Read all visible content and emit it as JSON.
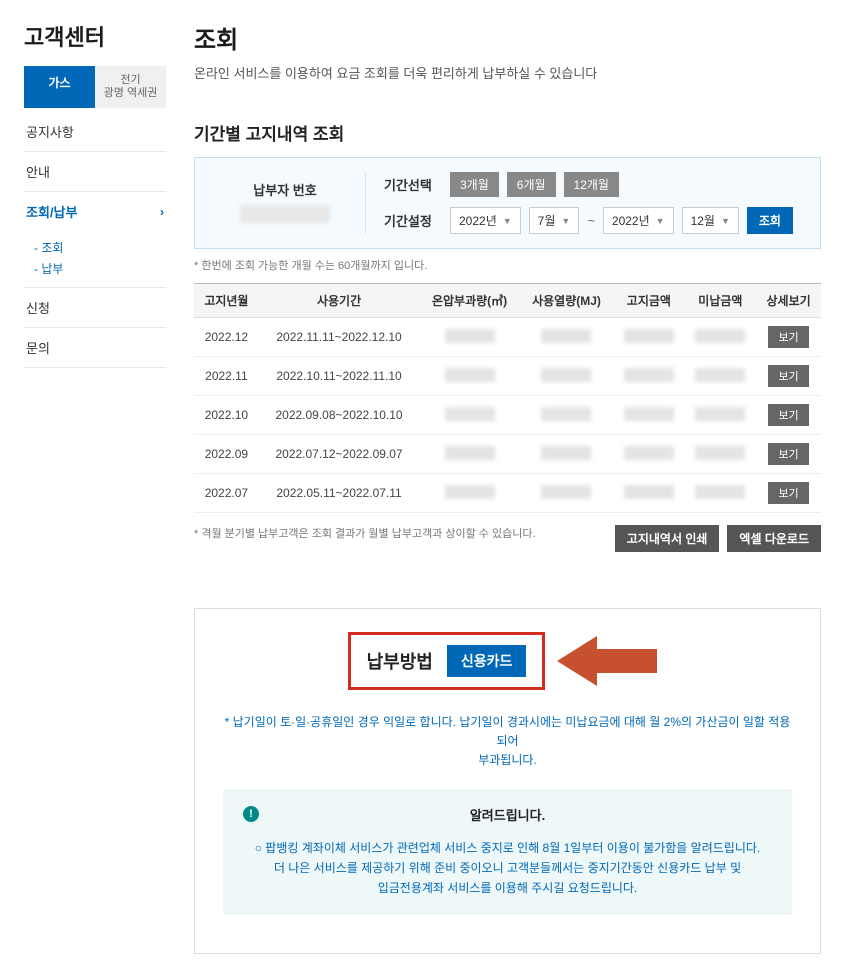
{
  "sidebar": {
    "title": "고객센터",
    "tabs": [
      {
        "label": "가스",
        "active": true
      },
      {
        "label_line1": "전기",
        "label_line2": "광명 역세권",
        "active": false
      }
    ],
    "items": [
      {
        "label": "공지사항",
        "active": false
      },
      {
        "label": "안내",
        "active": false
      },
      {
        "label": "조회/납부",
        "active": true,
        "has_chev": true,
        "sub": [
          "- 조회",
          "- 납부"
        ]
      },
      {
        "label": "신청",
        "active": false
      },
      {
        "label": "문의",
        "active": false
      }
    ]
  },
  "main": {
    "title": "조회",
    "subtitle": "온라인 서비스를 이용하여 요금 조회를 더욱 편리하게 납부하실 수 있습니다"
  },
  "query": {
    "section_title": "기간별 고지내역 조회",
    "payer_label": "납부자 번호",
    "period_select_label": "기간선택",
    "period_chips": [
      "3개월",
      "6개월",
      "12개월"
    ],
    "period_set_label": "기간설정",
    "from_year": "2022년",
    "from_month": "7월",
    "to_year": "2022년",
    "to_month": "12월",
    "query_btn": "조회",
    "note": "* 한번에 조회 가능한 개월 수는 60개월까지 입니다."
  },
  "table": {
    "headers": [
      "고지년월",
      "사용기간",
      "온압부과량(㎥)",
      "사용열량(MJ)",
      "고지금액",
      "미납금액",
      "상세보기"
    ],
    "rows": [
      {
        "bill_ym": "2022.12",
        "period": "2022.11.11~2022.12.10"
      },
      {
        "bill_ym": "2022.11",
        "period": "2022.10.11~2022.11.10"
      },
      {
        "bill_ym": "2022.10",
        "period": "2022.09.08~2022.10.10"
      },
      {
        "bill_ym": "2022.09",
        "period": "2022.07.12~2022.09.07"
      },
      {
        "bill_ym": "2022.07",
        "period": "2022.05.11~2022.07.11"
      }
    ],
    "view_btn": "보기",
    "note": "* 격월 분기별 납부고객은 조회 결과가 월별 납부고객과 상이할 수 있습니다.",
    "action_print": "고지내역서 인쇄",
    "action_excel": "엑셀 다운로드"
  },
  "payment": {
    "label": "납부방법",
    "method": "신용카드",
    "note_line1": "* 납기일이 토·일·공휴일인 경우 익일로 합니다. 납기일이 경과시에는 미납요금에 대해 월 2%의 가산금이 일할 적용되어",
    "note_line2": "부과됩니다.",
    "alert_title": "알려드립니다.",
    "alert_body_line1": "○ 팝뱅킹 계좌이체 서비스가 관련업체 서비스 중지로 인해 8월 1일부터 이용이 불가함을 알려드립니다.",
    "alert_body_line2": "더 나은 서비스를 제공하기 위해 준비 중이오니 고객분들께서는 중지기간동안 신용카드 납부 및",
    "alert_body_line3": "입금전용계좌 서비스를 이용해 주시길 요청드립니다."
  }
}
